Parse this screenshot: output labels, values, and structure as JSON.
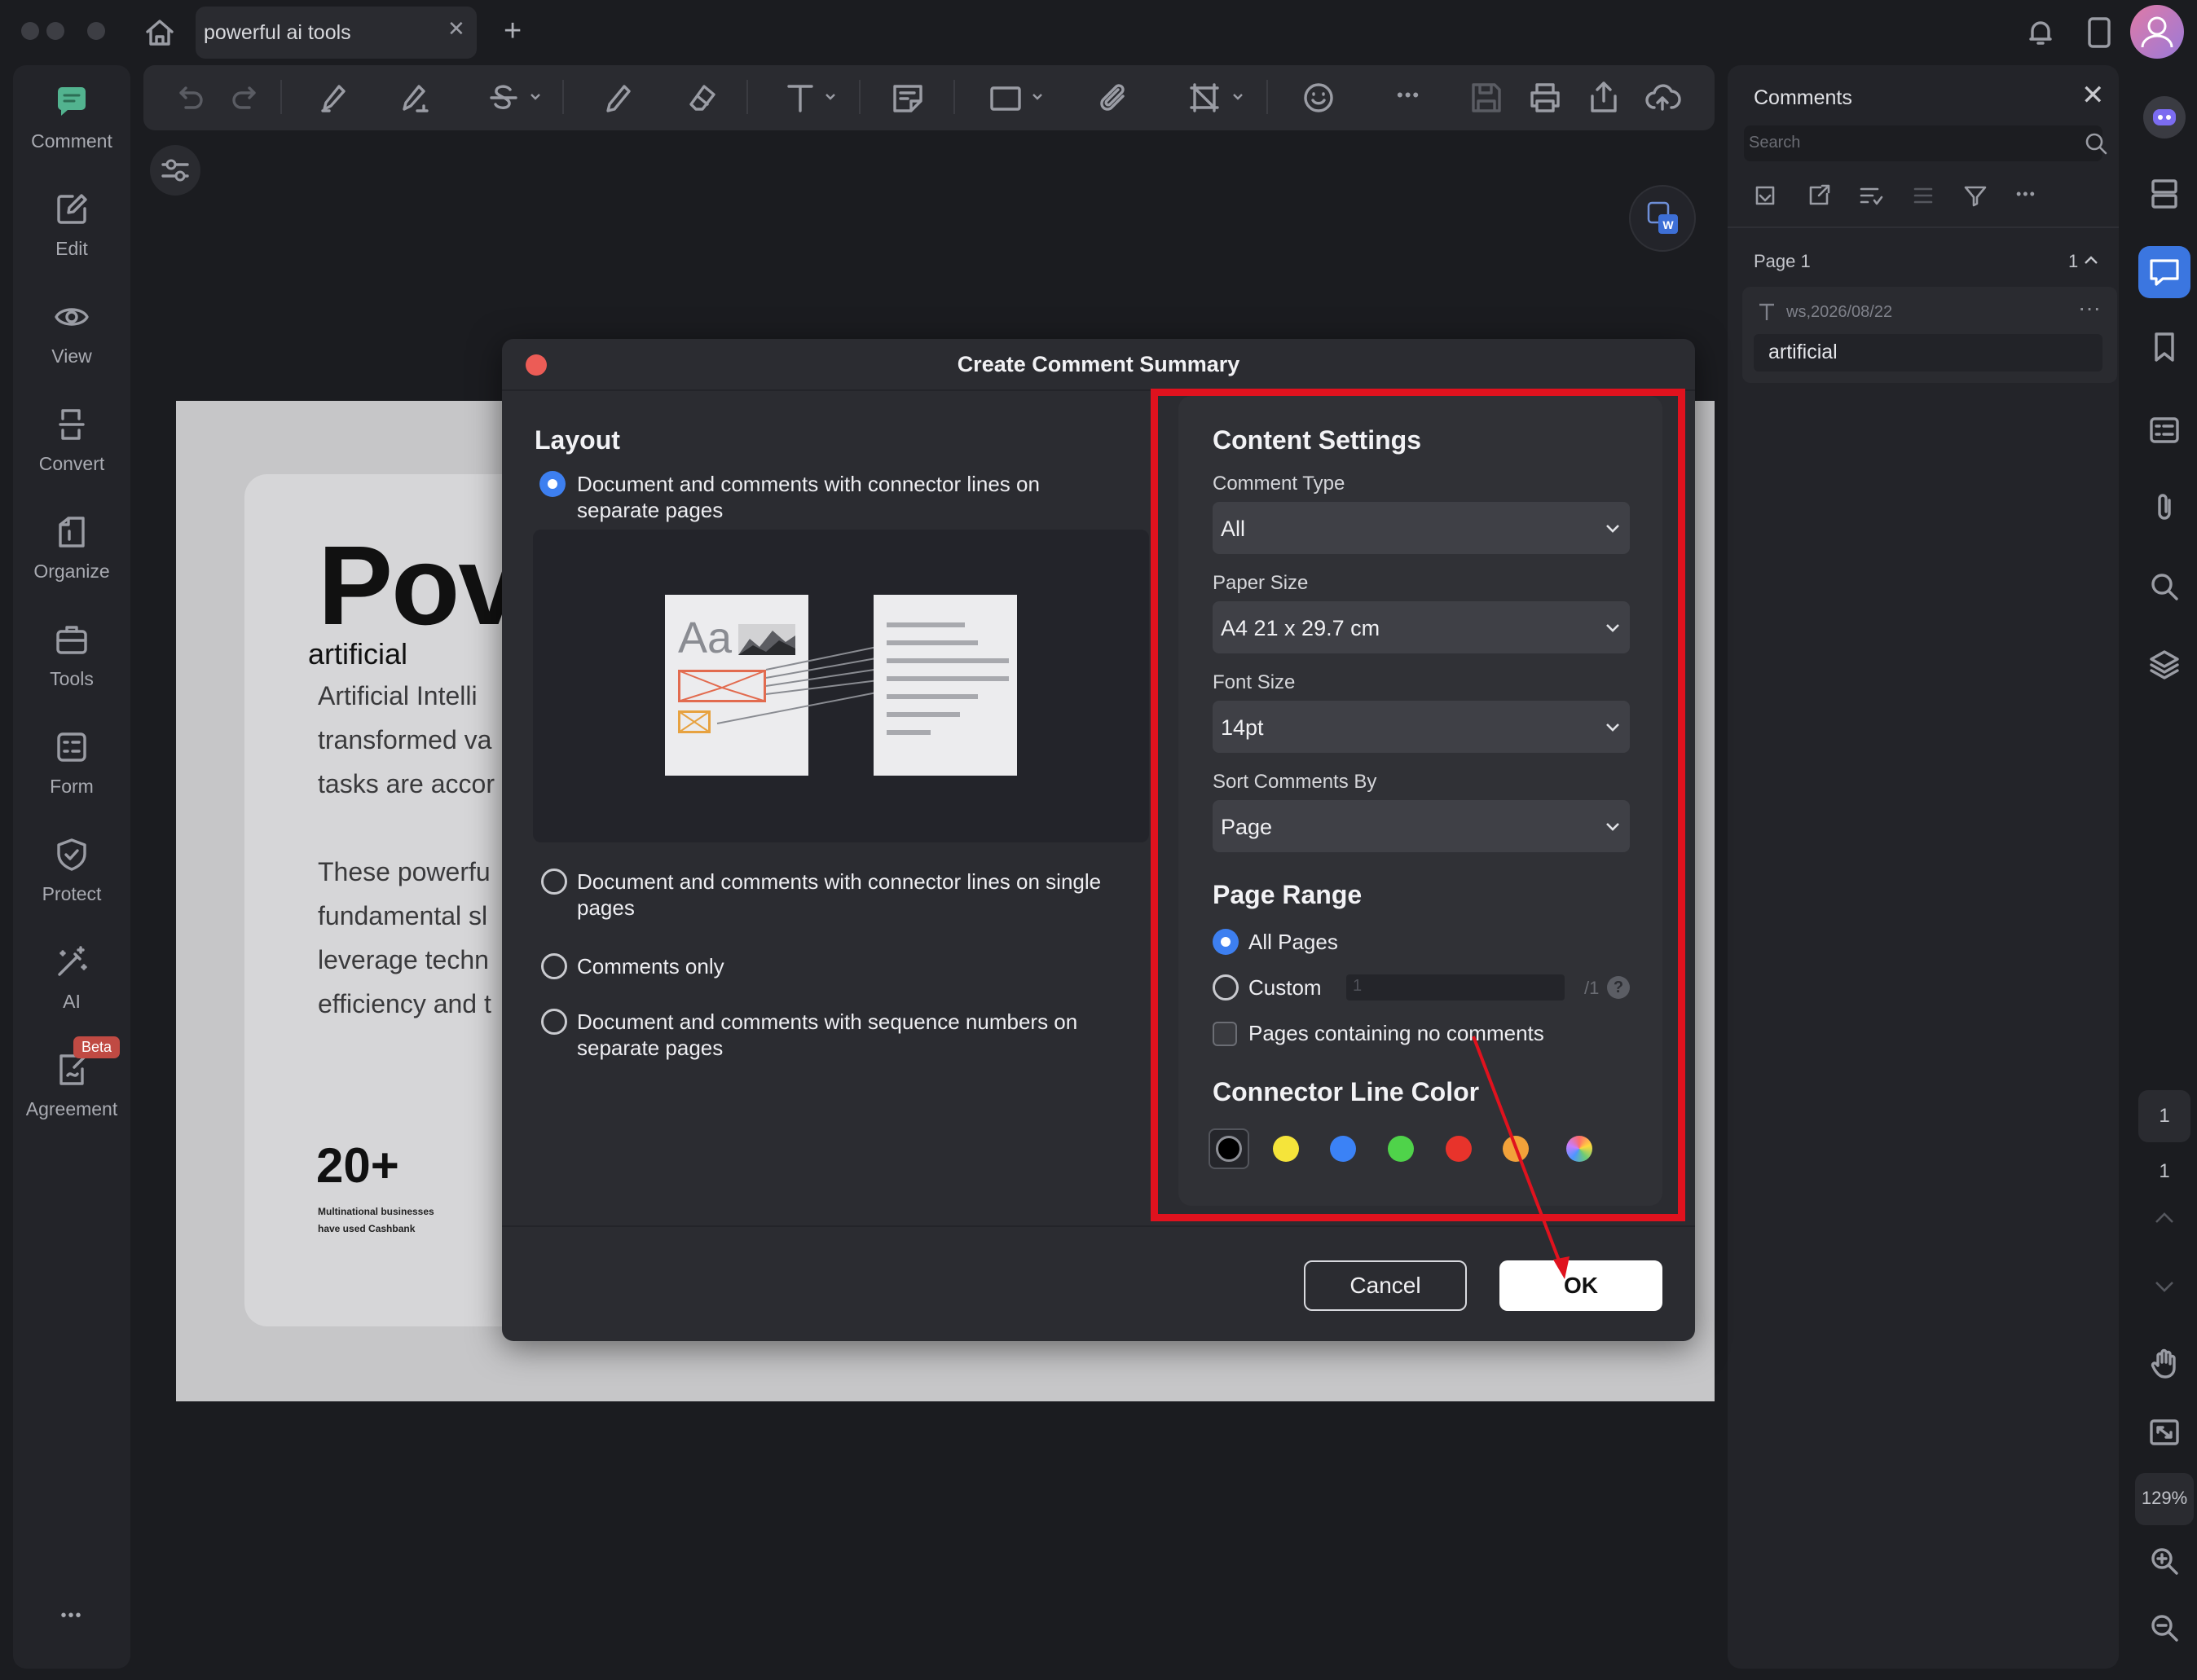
{
  "tab": {
    "title": "powerful ai tools",
    "close": "✕",
    "new": "+"
  },
  "left_nav": [
    {
      "label": "Comment",
      "icon": "comment-icon"
    },
    {
      "label": "Edit",
      "icon": "edit-icon"
    },
    {
      "label": "View",
      "icon": "eye-icon"
    },
    {
      "label": "Convert",
      "icon": "convert-icon"
    },
    {
      "label": "Organize",
      "icon": "organize-icon"
    },
    {
      "label": "Tools",
      "icon": "toolbox-icon"
    },
    {
      "label": "Form",
      "icon": "form-icon"
    },
    {
      "label": "Protect",
      "icon": "shield-icon"
    },
    {
      "label": "AI",
      "icon": "magic-wand-icon"
    },
    {
      "label": "Agreement",
      "icon": "agreement-icon"
    }
  ],
  "beta_badge": "Beta",
  "more_glyph": "•••",
  "document": {
    "heading": "Pov",
    "comment_label": "artificial",
    "para1": [
      "Artificial Intelli",
      "transformed va",
      "tasks are accor"
    ],
    "para2": [
      "These powerfu",
      "fundamental sl",
      "leverage techn",
      "efficiency and t"
    ],
    "stat": "20+",
    "stat_caption": [
      "Multinational businesses",
      "have used Cashbank"
    ]
  },
  "comments_panel": {
    "title": "Comments",
    "close": "✕",
    "search_placeholder": "Search",
    "page_label": "Page 1",
    "page_count": "1",
    "comment": {
      "meta": "ws,2026/08/22",
      "menu": "···",
      "text": "artificial"
    }
  },
  "rail": {
    "page_current": "1",
    "page_total": "1",
    "zoom": "129%"
  },
  "modal": {
    "title": "Create Comment Summary",
    "layout": {
      "title": "Layout",
      "options": [
        {
          "lines": [
            "Document and comments with connector lines on",
            "separate pages"
          ],
          "selected": true
        },
        {
          "lines": [
            "Document and comments with connector lines on single",
            "pages"
          ],
          "selected": false
        },
        {
          "lines": [
            "Comments only"
          ],
          "selected": false
        },
        {
          "lines": [
            "Document and comments with sequence numbers on",
            "separate pages"
          ],
          "selected": false
        }
      ],
      "preview_text": "Aa"
    },
    "content_settings": {
      "title": "Content Settings",
      "comment_type": {
        "label": "Comment Type",
        "value": "All"
      },
      "paper_size": {
        "label": "Paper Size",
        "value": "A4 21 x 29.7 cm"
      },
      "font_size": {
        "label": "Font Size",
        "value": "14pt"
      },
      "sort_by": {
        "label": "Sort Comments By",
        "value": "Page"
      }
    },
    "page_range": {
      "title": "Page Range",
      "all_pages": "All Pages",
      "custom": "Custom",
      "custom_value": "1",
      "custom_total": "/1",
      "help": "?",
      "no_comments": "Pages containing no comments"
    },
    "connector_color": {
      "title": "Connector Line Color",
      "swatches": [
        "#000000",
        "#f5e43a",
        "#3b82f6",
        "#4fd34a",
        "#e8332b",
        "#f2a23a",
        "rainbow"
      ]
    },
    "cancel": "Cancel",
    "ok": "OK"
  },
  "annotation_color": "#e0121e"
}
